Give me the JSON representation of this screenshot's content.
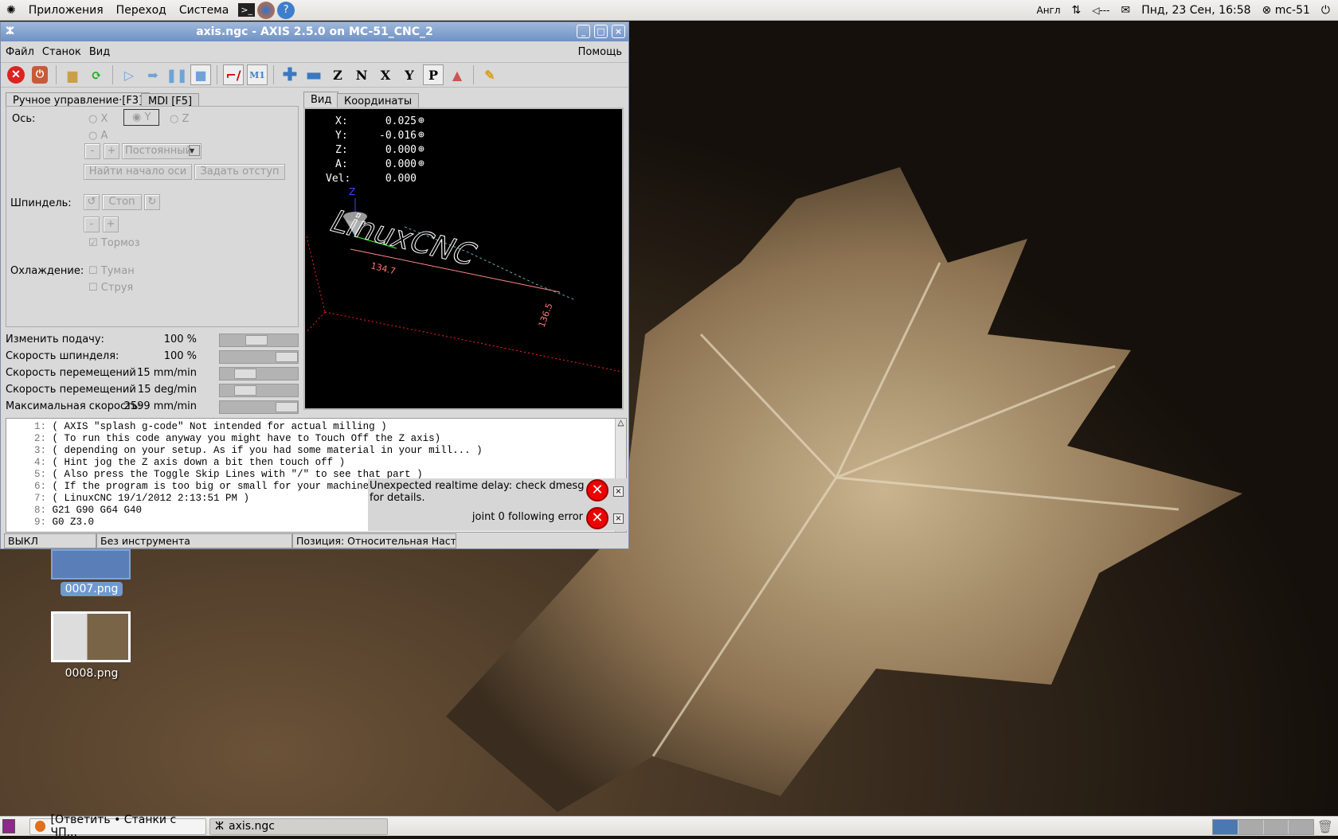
{
  "top_panel": {
    "menus": [
      "Приложения",
      "Переход",
      "Система"
    ],
    "launchers": [
      "terminal-icon",
      "firefox-icon",
      "help-icon"
    ],
    "keyboard": "Англ",
    "volume": "◁---",
    "datetime": "Пнд, 23 Сен, 16:58",
    "user": "mc-51"
  },
  "window": {
    "title": "axis.ngc - AXIS 2.5.0 on MC-51_CNC_2",
    "menu": [
      "Файл",
      "Станок",
      "Вид"
    ],
    "help": "Помощь",
    "toolbar": [
      "estop",
      "power",
      "open",
      "reload",
      "run",
      "step",
      "pause",
      "stop",
      "skip-lines",
      "optional-stop",
      "zoom-in",
      "zoom-out",
      "view-z",
      "view-z2",
      "view-x",
      "view-y",
      "view-p",
      "rotate",
      "clear-plot"
    ],
    "left_tabs": [
      "Ручное управление·[F3]",
      "MDI [F5]"
    ],
    "manual": {
      "axis_label": "Ось:",
      "axes": [
        "X",
        "Y",
        "Z",
        "A"
      ],
      "selected_axis": "Y",
      "minus": "-",
      "plus": "+",
      "jog_mode": "Постоянный",
      "home_button": "Найти начало оси",
      "touch_off_button": "Задать отступ",
      "spindle_label": "Шпиндель:",
      "spindle_stop": "Стоп",
      "brake": "Тормоз",
      "brake_checked": true,
      "coolant_label": "Охлаждение:",
      "mist": "Туман",
      "flood": "Струя"
    },
    "overrides": [
      {
        "label": "Изменить подачу:",
        "value": "100 %",
        "fraction": 0.45
      },
      {
        "label": "Скорость шпинделя:",
        "value": "100 %",
        "fraction": 1.0
      },
      {
        "label": "Скорость перемещений",
        "value": "15 mm/min",
        "fraction": 0.25
      },
      {
        "label": "Скорость перемещений",
        "value": "15 deg/min",
        "fraction": 0.25
      },
      {
        "label": "Максимальная скорость:",
        "value": "2599 mm/min",
        "fraction": 1.0
      }
    ],
    "right_tabs": [
      "Вид",
      "Координаты"
    ],
    "dro": [
      {
        "axis": "X:",
        "value": "0.025"
      },
      {
        "axis": "Y:",
        "value": "-0.016"
      },
      {
        "axis": "Z:",
        "value": "0.000"
      },
      {
        "axis": "A:",
        "value": "0.000"
      },
      {
        "axis": "Vel:",
        "value": "0.000"
      }
    ],
    "preview": {
      "axis_z": "Z",
      "dim_x": "134.7",
      "dim_y": "136.5",
      "logo": "LinuxCNC"
    },
    "gcode": [
      {
        "n": "1:",
        "text": "( AXIS \"splash g-code\" Not intended for actual milling )"
      },
      {
        "n": "2:",
        "text": "( To run this code anyway you might have to Touch Off the Z axis)"
      },
      {
        "n": "3:",
        "text": "( depending on your setup. As if you had some material in your mill... )"
      },
      {
        "n": "4:",
        "text": "( Hint jog the Z axis down a bit then touch off )"
      },
      {
        "n": "5:",
        "text": "( Also press the Toggle Skip Lines with \"/\" to see that part )"
      },
      {
        "n": "6:",
        "text": "( If the program is too big or small for your machine, ch"
      },
      {
        "n": "7:",
        "text": "( LinuxCNC 19/1/2012 2:13:51 PM )"
      },
      {
        "n": "8:",
        "text": "G21 G90 G64 G40"
      },
      {
        "n": "9:",
        "text": "G0 Z3.0"
      }
    ],
    "status": [
      "ВЫКЛ",
      "Без инструмента",
      "Позиция: Относительная Насто:"
    ],
    "notifications": [
      "Unexpected realtime delay: check dmesg for details.",
      "joint 0 following error"
    ]
  },
  "desktop": [
    "0007.png",
    "0008.png"
  ],
  "taskbar": [
    "[Ответить • Станки с ЧП...",
    "axis.ngc"
  ]
}
